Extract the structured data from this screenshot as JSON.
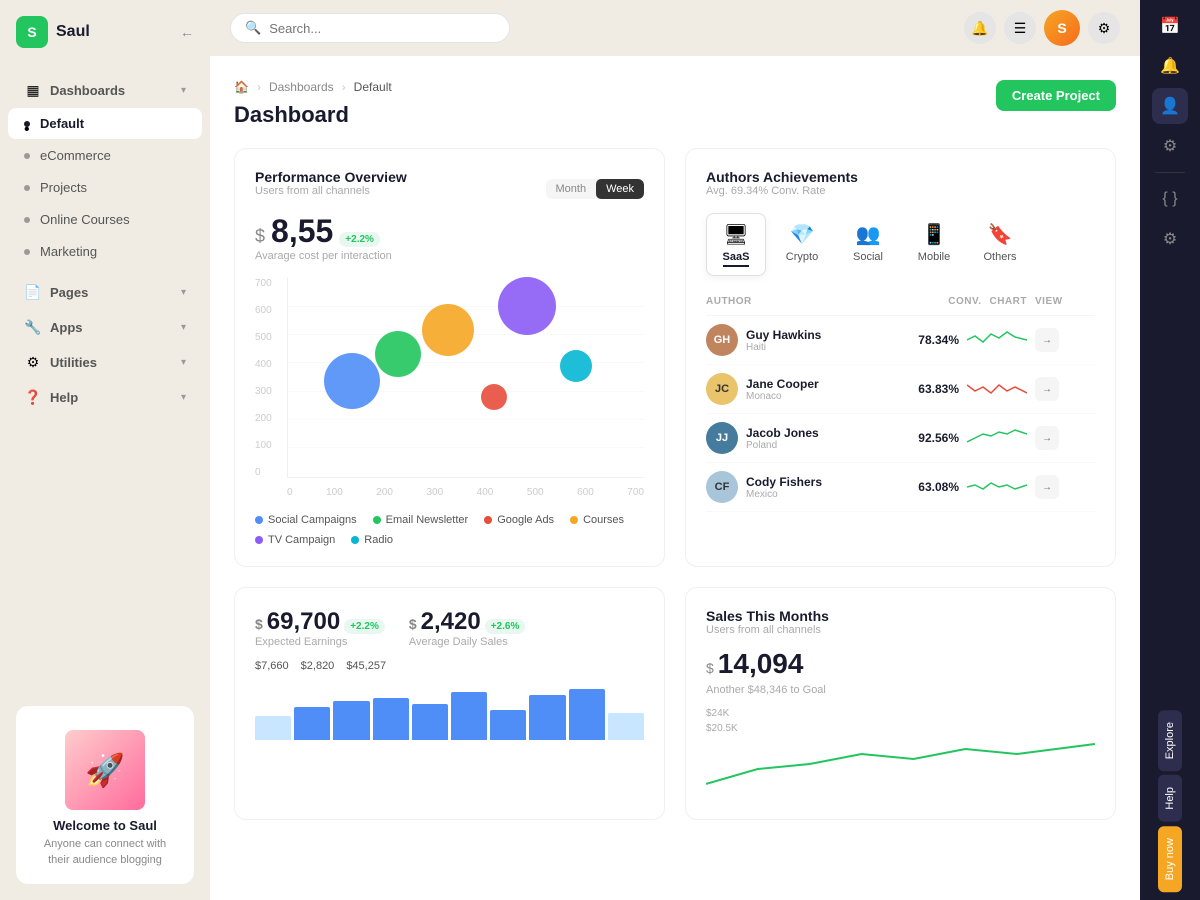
{
  "app": {
    "name": "Saul",
    "logo": "S"
  },
  "topbar": {
    "search_placeholder": "Search...",
    "search_label": "Search _"
  },
  "sidebar": {
    "sections": [
      {
        "id": "dashboards",
        "label": "Dashboards",
        "icon": "▦",
        "has_arrow": true
      },
      {
        "id": "default",
        "label": "Default",
        "active": true,
        "is_child": true
      },
      {
        "id": "ecommerce",
        "label": "eCommerce",
        "is_child": true
      },
      {
        "id": "projects",
        "label": "Projects",
        "is_child": true
      },
      {
        "id": "online-courses",
        "label": "Online Courses",
        "is_child": true
      },
      {
        "id": "marketing",
        "label": "Marketing",
        "is_child": true
      },
      {
        "id": "pages",
        "label": "Pages",
        "icon": "📄",
        "has_arrow": true
      },
      {
        "id": "apps",
        "label": "Apps",
        "icon": "🔧",
        "has_arrow": true
      },
      {
        "id": "utilities",
        "label": "Utilities",
        "icon": "⚙",
        "has_arrow": true
      },
      {
        "id": "help",
        "label": "Help",
        "icon": "❓",
        "has_arrow": true
      }
    ],
    "welcome": {
      "title": "Welcome to Saul",
      "subtitle": "Anyone can connect with their audience blogging"
    }
  },
  "breadcrumb": {
    "home": "🏠",
    "section": "Dashboards",
    "current": "Default"
  },
  "page": {
    "title": "Dashboard"
  },
  "create_btn": "Create Project",
  "performance": {
    "title": "Performance Overview",
    "subtitle": "Users from all channels",
    "tab_month": "Month",
    "tab_week": "Week",
    "value": "8,55",
    "badge": "+2.2%",
    "value_label": "Avarage cost per interaction",
    "bubbles": [
      {
        "x": 18,
        "y": 52,
        "size": 56,
        "color": "#4f8ef7",
        "label": "Social Campaigns"
      },
      {
        "x": 31,
        "y": 42,
        "size": 46,
        "color": "#22c55e",
        "label": "Email Newsletter"
      },
      {
        "x": 44,
        "y": 33,
        "size": 52,
        "color": "#f5a623",
        "label": "Courses"
      },
      {
        "x": 57,
        "y": 40,
        "size": 26,
        "color": "#e74c3c",
        "label": "Google Ads"
      },
      {
        "x": 67,
        "y": 22,
        "size": 58,
        "color": "#8b5cf6",
        "label": "TV Campaign"
      },
      {
        "x": 82,
        "y": 48,
        "size": 32,
        "color": "#06b6d4",
        "label": "Radio"
      }
    ],
    "y_labels": [
      "700",
      "600",
      "500",
      "400",
      "300",
      "200",
      "100",
      "0"
    ],
    "x_labels": [
      "0",
      "100",
      "200",
      "300",
      "400",
      "500",
      "600",
      "700"
    ],
    "legend": [
      {
        "color": "#4f8ef7",
        "label": "Social Campaigns"
      },
      {
        "color": "#22c55e",
        "label": "Email Newsletter"
      },
      {
        "color": "#e74c3c",
        "label": "Google Ads"
      },
      {
        "color": "#f5a623",
        "label": "Courses"
      },
      {
        "color": "#8b5cf6",
        "label": "TV Campaign"
      },
      {
        "color": "#06b6d4",
        "label": "Radio"
      }
    ]
  },
  "authors": {
    "title": "Authors Achievements",
    "subtitle": "Avg. 69.34% Conv. Rate",
    "tabs": [
      {
        "id": "saas",
        "label": "SaaS",
        "icon": "🖥",
        "active": true
      },
      {
        "id": "crypto",
        "label": "Crypto",
        "icon": "💎",
        "active": false
      },
      {
        "id": "social",
        "label": "Social",
        "icon": "👥",
        "active": false
      },
      {
        "id": "mobile",
        "label": "Mobile",
        "icon": "📱",
        "active": false
      },
      {
        "id": "others",
        "label": "Others",
        "icon": "🔖",
        "active": false
      }
    ],
    "col_author": "AUTHOR",
    "col_conv": "CONV.",
    "col_chart": "CHART",
    "col_view": "VIEW",
    "rows": [
      {
        "name": "Guy Hawkins",
        "country": "Haiti",
        "conv": "78.34%",
        "color": "#22c55e",
        "bg": "#d4a373"
      },
      {
        "name": "Jane Cooper",
        "country": "Monaco",
        "conv": "63.83%",
        "color": "#e74c3c",
        "bg": "#e9c46a"
      },
      {
        "name": "Jacob Jones",
        "country": "Poland",
        "conv": "92.56%",
        "color": "#22c55e",
        "bg": "#457b9d"
      },
      {
        "name": "Cody Fishers",
        "country": "Mexico",
        "conv": "63.08%",
        "color": "#22c55e",
        "bg": "#a8c5da"
      }
    ]
  },
  "earnings": {
    "title": "Expected Earnings",
    "value": "69,700",
    "badge": "+2.2%",
    "label": "Expected Earnings"
  },
  "daily_sales": {
    "value": "2,420",
    "badge": "+2.6%",
    "label": "Average Daily Sales"
  },
  "bar_values": [
    "$7,660",
    "$2,820",
    "$45,257"
  ],
  "bars": [
    40,
    55,
    65,
    70,
    60,
    80,
    50,
    75,
    85,
    45
  ],
  "sales": {
    "title": "Sales This Months",
    "subtitle": "Users from all channels",
    "value": "14,094",
    "goal_label": "Another $48,346 to Goal",
    "y1": "$24K",
    "y2": "$20.5K"
  },
  "right_sidebar": {
    "explore": "Explore",
    "help": "Help",
    "buy": "Buy now"
  }
}
